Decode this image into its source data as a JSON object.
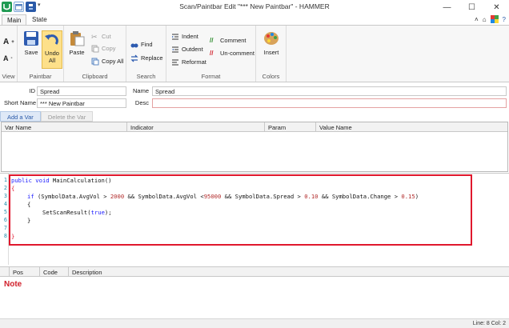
{
  "window": {
    "title": "Scan/Paintbar Edit \"*** New Paintbar\" - HAMMER",
    "controls": [
      "minimize",
      "maximize",
      "close"
    ]
  },
  "ribbon_tabs": [
    {
      "label": "Main",
      "active": true
    },
    {
      "label": "State",
      "active": false
    }
  ],
  "ribbon": {
    "view": {
      "label": "View"
    },
    "paintbar": {
      "label": "Paintbar",
      "save": "Save",
      "undo": "Undo All"
    },
    "clipboard": {
      "label": "Clipboard",
      "paste": "Paste",
      "cut": "Cut",
      "copy": "Copy",
      "copy_all": "Copy All"
    },
    "search": {
      "label": "Search",
      "find": "Find",
      "replace": "Replace"
    },
    "format": {
      "label": "Format",
      "indent": "Indent",
      "outdent": "Outdent",
      "reformat": "Reformat",
      "comment": "Comment",
      "uncomment": "Un-comment"
    },
    "colors": {
      "label": "Colors",
      "insert": "Insert"
    }
  },
  "form": {
    "id_label": "ID",
    "id_value": "Spread",
    "name_label": "Name",
    "name_value": "Spread",
    "short_name_label": "Short Name",
    "short_name_value": "*** New Paintbar",
    "desc_label": "Desc",
    "desc_value": ""
  },
  "var_tools": {
    "add": "Add a Var",
    "delete": "Delete the Var"
  },
  "var_grid": {
    "columns": [
      "Var Name",
      "Indicator",
      "Param",
      "Value Name"
    ]
  },
  "editor": {
    "line_numbers": [
      "1",
      "2",
      "3",
      "4",
      "5",
      "6",
      "7",
      "8"
    ],
    "lines": {
      "l1_kw": "public void",
      "l1_rest": " MainCalculation()",
      "l2": "{",
      "l3_kw": "if",
      "l3_a": " (SymbolData.AvgVol > ",
      "l3_n1": "2000",
      "l3_b": " && SymbolData.AvgVol <",
      "l3_n2": "95000",
      "l3_c": " && SymbolData.Spread > ",
      "l3_n3": "0.10",
      "l3_d": " && SymbolData.Change > ",
      "l3_n4": "0.15",
      "l3_e": ")",
      "l4": "{",
      "l5_a": "SetScanResult(",
      "l5_kw": "true",
      "l5_b": ");",
      "l6": "}",
      "l8": "}"
    }
  },
  "error_grid": {
    "columns": [
      "Pos",
      "Code",
      "Description"
    ]
  },
  "note": "Note",
  "status": "Line: 8  Col: 2",
  "colors": {
    "highlight_border": "#e0182d",
    "keyword": "#1a1aff",
    "number": "#b22b2b",
    "note": "#d1202b"
  }
}
